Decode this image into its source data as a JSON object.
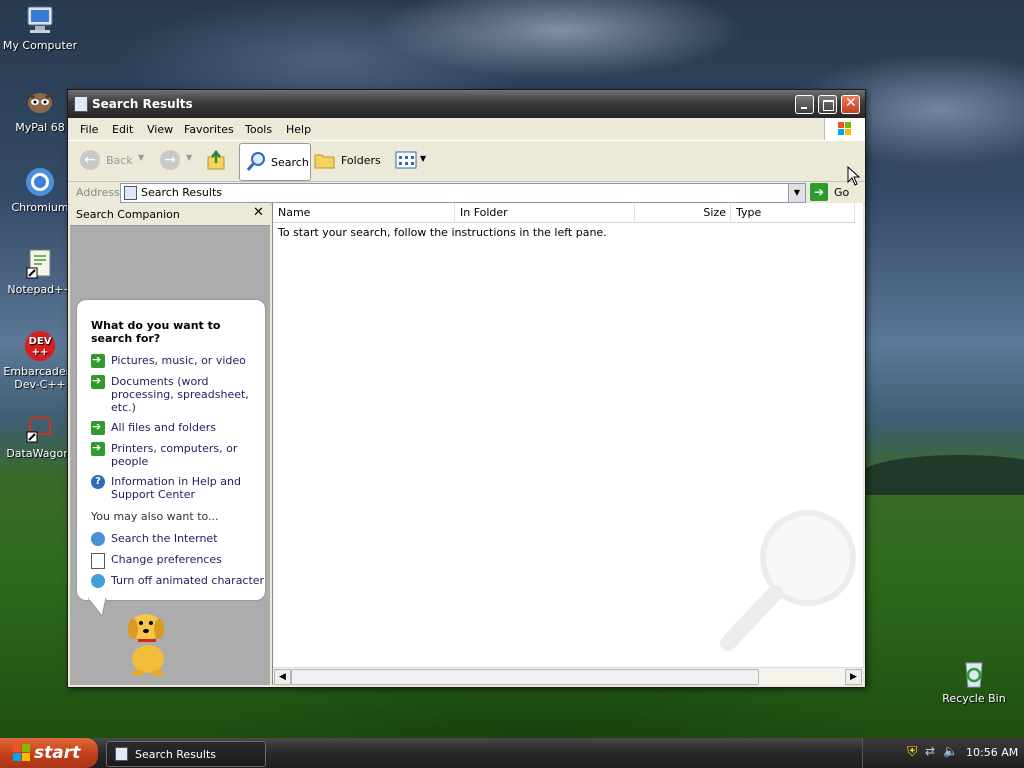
{
  "desktop": {
    "icons": [
      {
        "label": "My Computer"
      },
      {
        "label": "MyPal 68"
      },
      {
        "label": "Chromium"
      },
      {
        "label": "Notepad++"
      },
      {
        "label": "Embarcadero Dev-C++"
      },
      {
        "label": "DataWagon."
      },
      {
        "label": "Recycle Bin"
      }
    ]
  },
  "window": {
    "title": "Search Results",
    "menu": [
      "File",
      "Edit",
      "View",
      "Favorites",
      "Tools",
      "Help"
    ],
    "toolbar": {
      "back": "Back",
      "search": "Search",
      "folders": "Folders"
    },
    "address": {
      "label": "Address",
      "value": "Search Results",
      "go": "Go"
    },
    "companion": {
      "title": "Search Companion",
      "question": "What do you want to search for?",
      "options": [
        "Pictures, music, or video",
        "Documents (word processing, spreadsheet, etc.)",
        "All files and folders",
        "Printers, computers, or people",
        "Information in Help and Support Center"
      ],
      "also_label": "You may also want to...",
      "also": [
        "Search the Internet",
        "Change preferences",
        "Turn off animated character"
      ]
    },
    "results": {
      "columns": [
        "Name",
        "In Folder",
        "Size",
        "Type"
      ],
      "message": "To start your search, follow the instructions in the left pane."
    }
  },
  "taskbar": {
    "start": "start",
    "task": "Search Results",
    "clock": "10:56 AM"
  }
}
